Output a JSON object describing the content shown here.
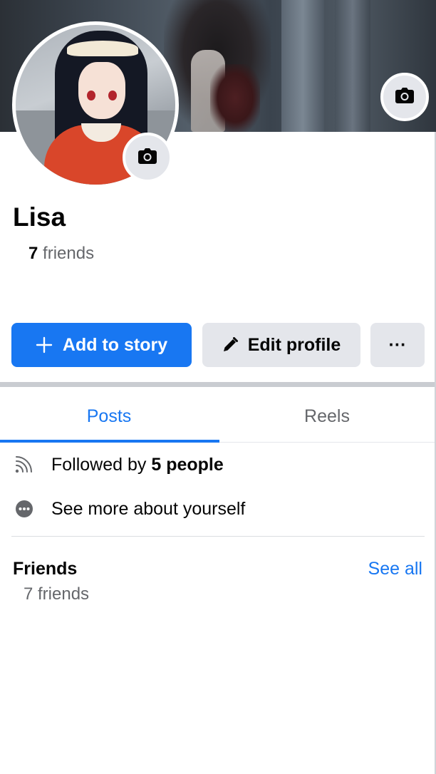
{
  "profile": {
    "name": "Lisa",
    "friends_count": "7",
    "friends_word": "friends"
  },
  "actions": {
    "add_story": "Add to story",
    "edit_profile": "Edit profile",
    "more": "···"
  },
  "tabs": [
    {
      "label": "Posts",
      "active": true
    },
    {
      "label": "Reels",
      "active": false
    }
  ],
  "details": {
    "followed_prefix": "Followed by ",
    "followed_count": "5 people",
    "see_more": "See more about yourself"
  },
  "friends_section": {
    "title": "Friends",
    "see_all": "See all",
    "subtitle": "7 friends"
  },
  "colors": {
    "accent": "#1877f2",
    "button_gray": "#e4e6eb",
    "secondary_text": "#65676b"
  },
  "icons": {
    "cover_camera": "camera-icon",
    "avatar_camera": "camera-icon",
    "add": "plus-icon",
    "edit": "pencil-icon",
    "more": "ellipsis-icon",
    "followed": "rss-feed-icon",
    "info": "more-info-icon"
  }
}
